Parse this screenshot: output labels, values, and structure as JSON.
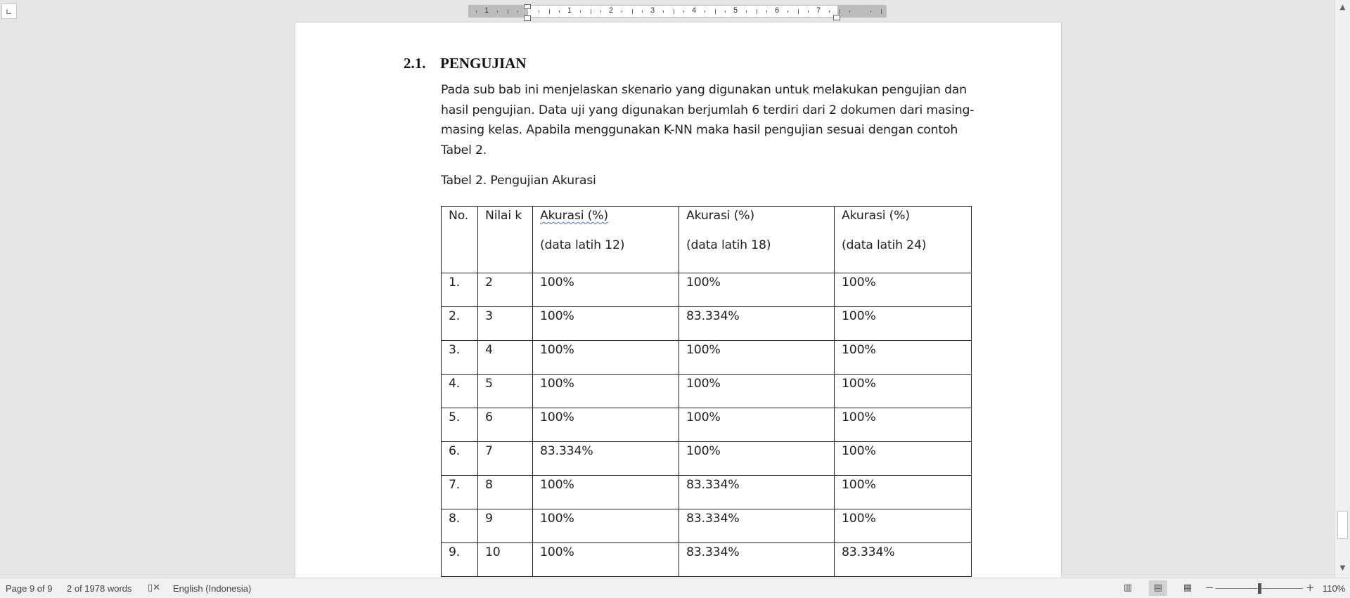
{
  "ruler": {
    "tab_selector_glyph": "∟",
    "numbers": [
      "1",
      "1",
      "2",
      "3",
      "4",
      "5",
      "6",
      "7"
    ]
  },
  "document": {
    "heading_number": "2.1.",
    "heading_title": "PENGUJIAN",
    "paragraph": "Pada sub bab ini menjelaskan skenario yang digunakan untuk melakukan pengujian dan hasil pengujian. Data uji yang digunakan berjumlah 6 terdiri dari 2 dokumen dari masing-masing kelas. Apabila menggunakan K-NN maka hasil pengujian sesuai dengan contoh Tabel 2.",
    "caption": "Tabel 2. Pengujian Akurasi",
    "table": {
      "headers": {
        "no": "No.",
        "nilai_k": "Nilai k",
        "col1_line1": "Akurasi  (%)",
        "col1_line2": "(data latih 12)",
        "col2_line1": "Akurasi (%)",
        "col2_line2": "(data latih 18)",
        "col3_line1": "Akurasi (%)",
        "col3_line2": "(data latih 24)"
      },
      "rows": [
        [
          "1.",
          "2",
          "100%",
          "100%",
          "100%"
        ],
        [
          "2.",
          "3",
          "100%",
          "83.334%",
          "100%"
        ],
        [
          "3.",
          "4",
          "100%",
          "100%",
          "100%"
        ],
        [
          "4.",
          "5",
          "100%",
          "100%",
          "100%"
        ],
        [
          "5.",
          "6",
          "100%",
          "100%",
          "100%"
        ],
        [
          "6.",
          "7",
          "83.334%",
          "100%",
          "100%"
        ],
        [
          "7.",
          "8",
          "100%",
          "83.334%",
          "100%"
        ],
        [
          "8.",
          "9",
          "100%",
          "83.334%",
          "100%"
        ],
        [
          "9.",
          "10",
          "100%",
          "83.334%",
          "83.334%"
        ]
      ]
    }
  },
  "statusbar": {
    "page": "Page 9 of 9",
    "words": "2 of 1978 words",
    "language": "English (Indonesia)",
    "zoom": "110%",
    "zoom_minus": "−",
    "zoom_plus": "+"
  },
  "icons": {
    "proofing": "proofing-icon",
    "read_mode": "read-mode-icon",
    "print_layout": "print-layout-icon",
    "web_layout": "web-layout-icon"
  }
}
